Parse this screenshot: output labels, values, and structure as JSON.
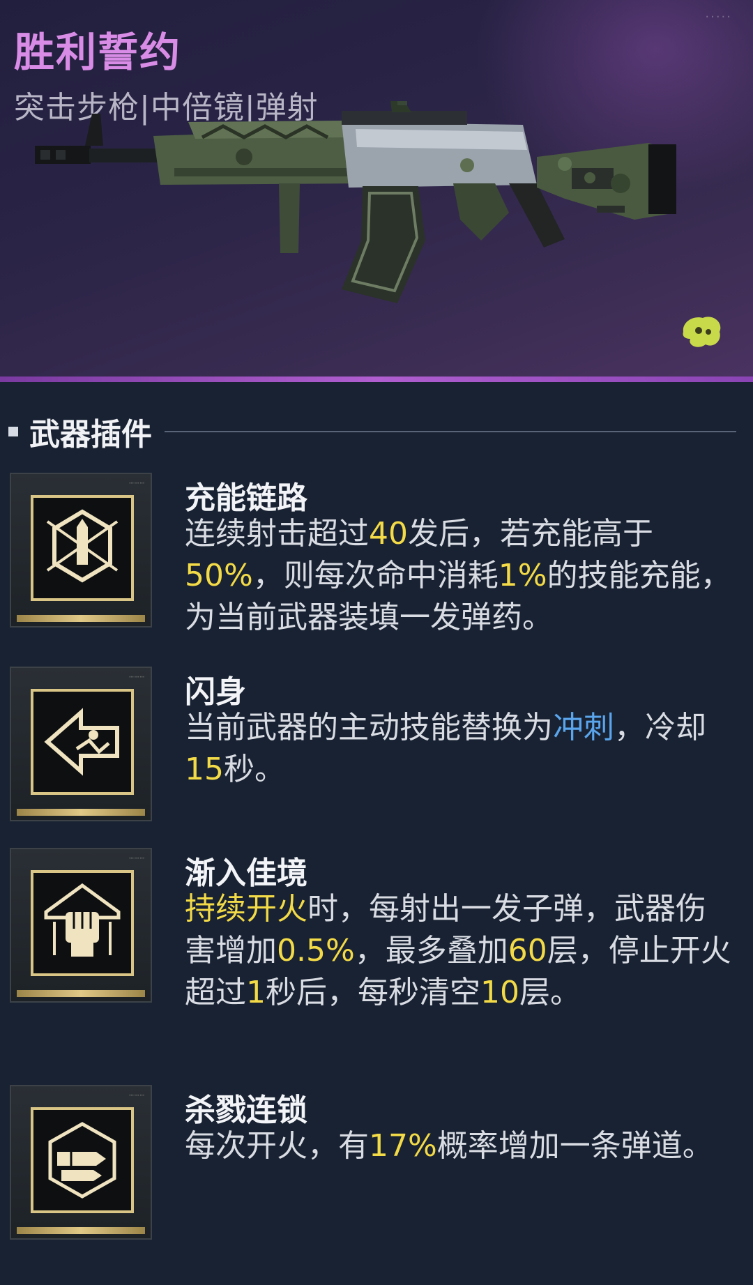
{
  "header": {
    "weapon_name": "胜利誓约",
    "weapon_tags": "突击步枪|中倍镜|弹射",
    "corner_mark": "·····",
    "image_icon": "assault-rifle-image",
    "badge_icon": "rarity-blob-icon"
  },
  "colors": {
    "name": "#d98ce6",
    "highlight_yellow": "#f3da47",
    "highlight_blue": "#5aa5ec",
    "divider": "#b05ed0",
    "gold": "#e0c987"
  },
  "section": {
    "title": "武器插件"
  },
  "mods": [
    {
      "title": "充能链路",
      "icon": "charge-link-icon",
      "desc": [
        {
          "t": "连续射击超过"
        },
        {
          "t": "40",
          "h": "y"
        },
        {
          "t": "发后，若充能高于"
        },
        {
          "t": "50%",
          "h": "y"
        },
        {
          "t": "，则每次命中消耗"
        },
        {
          "t": "1%",
          "h": "y"
        },
        {
          "t": "的技能充能，为当前武器装填一发弹药。"
        }
      ]
    },
    {
      "title": "闪身",
      "icon": "dash-arrow-icon",
      "desc": [
        {
          "t": "当前武器的主动技能替换为"
        },
        {
          "t": "冲刺",
          "h": "b"
        },
        {
          "t": "，冷却"
        },
        {
          "t": "15",
          "h": "y"
        },
        {
          "t": "秒。"
        }
      ]
    },
    {
      "title": "渐入佳境",
      "icon": "raised-fist-icon",
      "desc": [
        {
          "t": "持续开火",
          "h": "y"
        },
        {
          "t": "时，每射出一发子弹，武器伤害增加"
        },
        {
          "t": "0.5%",
          "h": "y"
        },
        {
          "t": "，最多叠加"
        },
        {
          "t": "60",
          "h": "y"
        },
        {
          "t": "层，停止开火超过"
        },
        {
          "t": "1",
          "h": "y"
        },
        {
          "t": "秒后，每秒清空"
        },
        {
          "t": "10",
          "h": "y"
        },
        {
          "t": "层。"
        }
      ]
    },
    {
      "title": "杀戮连锁",
      "icon": "bullet-chain-icon",
      "desc": [
        {
          "t": "每次开火，有"
        },
        {
          "t": "17%",
          "h": "y"
        },
        {
          "t": "概率增加一条弹道。"
        }
      ]
    }
  ]
}
